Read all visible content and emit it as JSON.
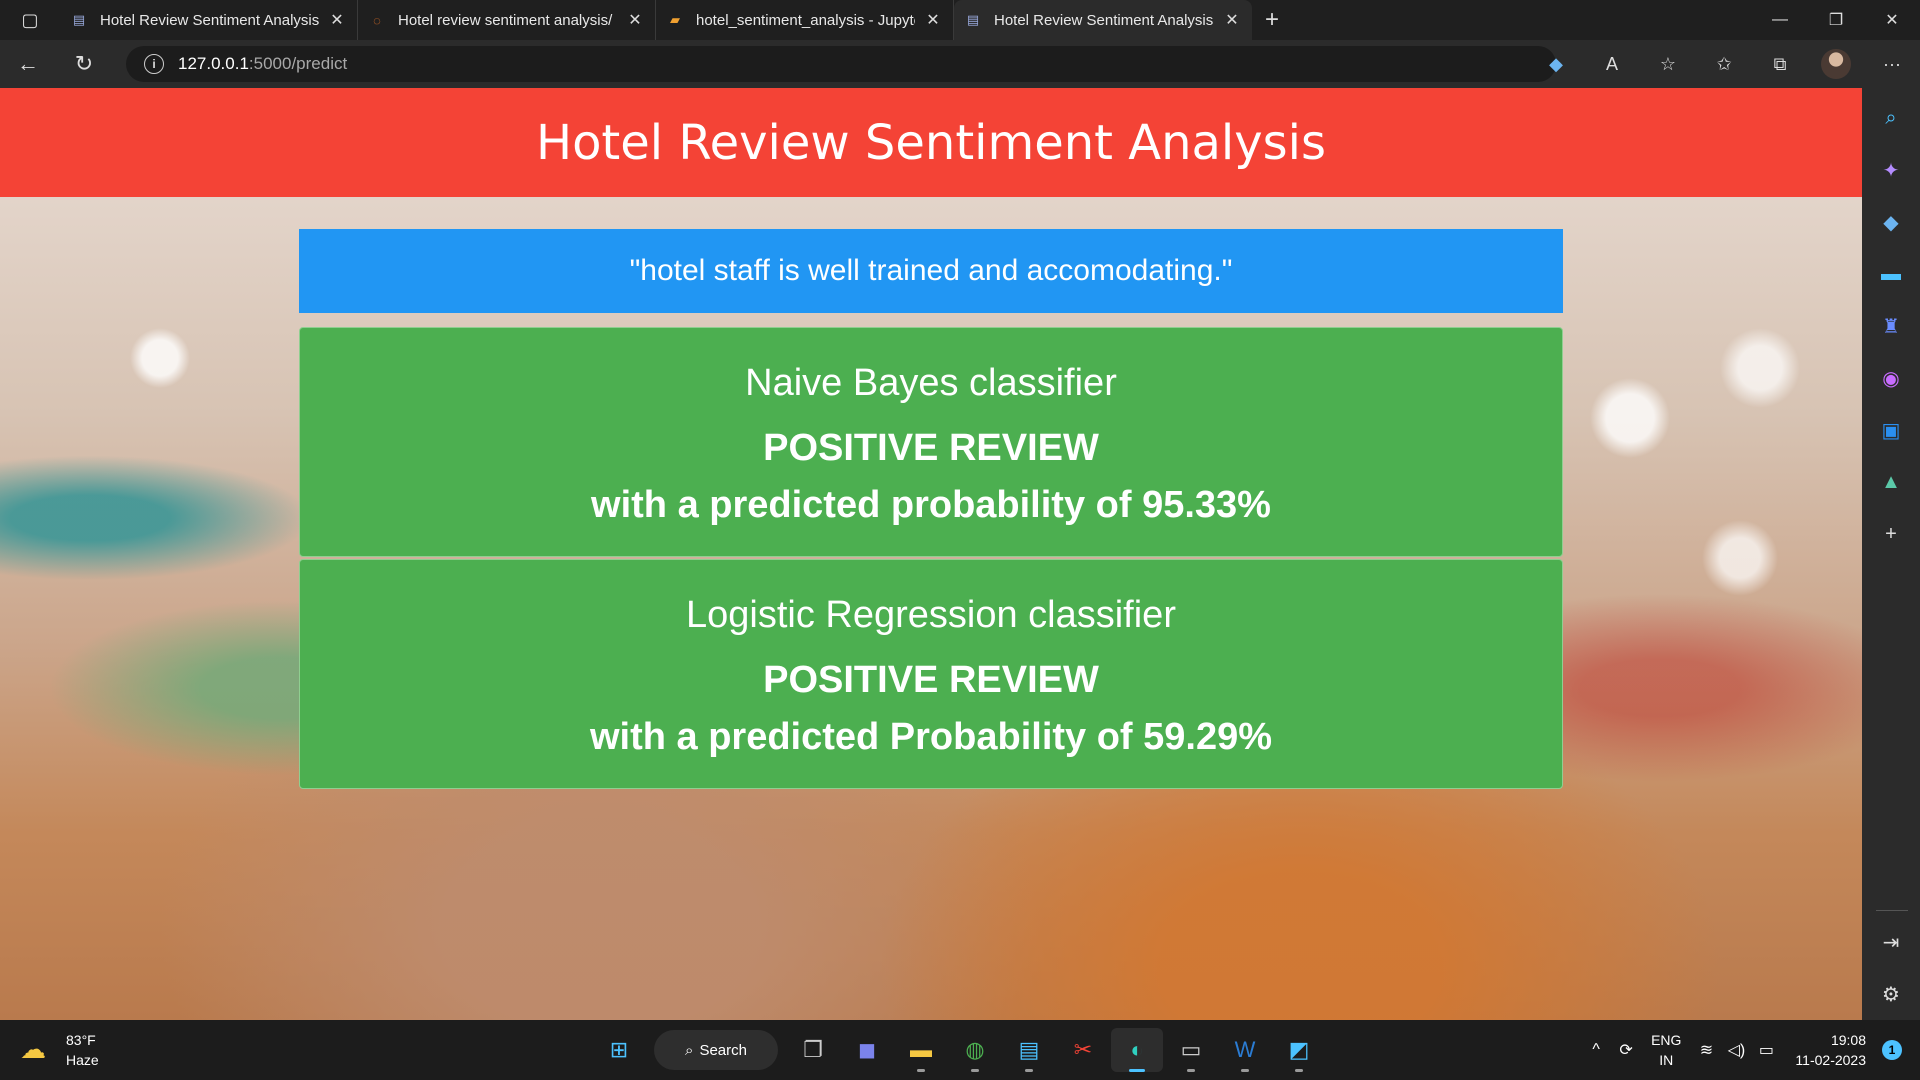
{
  "tabs": [
    {
      "label": "Hotel Review Sentiment Analysis",
      "icon": "app-icon",
      "active": false
    },
    {
      "label": "Hotel review sentiment analysis/",
      "icon": "jupyter-icon",
      "active": false
    },
    {
      "label": "hotel_sentiment_analysis - Jupyte",
      "icon": "notebook-icon",
      "active": false
    },
    {
      "label": "Hotel Review Sentiment Analysis",
      "icon": "app-icon",
      "active": true
    }
  ],
  "address": {
    "host": "127.0.0.1",
    "path": ":5000/predict"
  },
  "page": {
    "title": "Hotel Review Sentiment Analysis",
    "review_text": "\"hotel staff is well trained and accomodating.\"",
    "results": [
      {
        "classifier": "Naive Bayes classifier",
        "verdict": "POSITIVE REVIEW",
        "probability_text": "with a predicted probability of 95.33%"
      },
      {
        "classifier": "Logistic Regression classifier",
        "verdict": "POSITIVE REVIEW",
        "probability_text": "with a predicted Probability of 59.29%"
      }
    ],
    "colors": {
      "header": "#f44336",
      "review": "#2196f3",
      "card": "#4caf50"
    }
  },
  "taskbar": {
    "weather": {
      "temp": "83°F",
      "condition": "Haze"
    },
    "search_label": "Search",
    "lang": {
      "line1": "ENG",
      "line2": "IN"
    },
    "clock": {
      "time": "19:08",
      "date": "11-02-2023"
    },
    "notification_count": "1"
  }
}
